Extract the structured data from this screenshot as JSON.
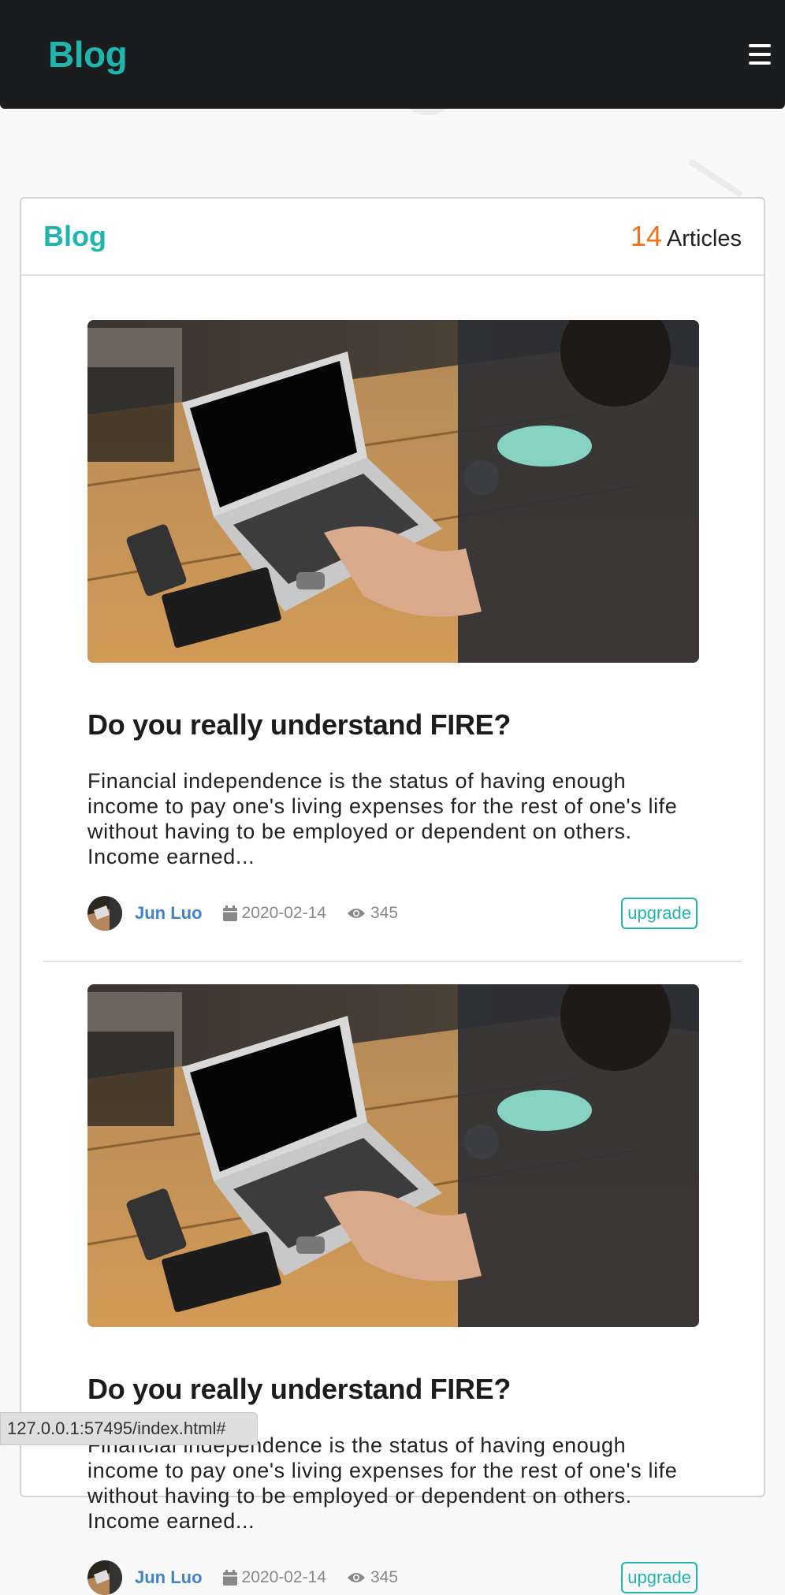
{
  "navbar": {
    "brand": "Blog",
    "menu_icon": "hamburger-menu-icon"
  },
  "card": {
    "title": "Blog",
    "count": "14",
    "count_label": "Articles"
  },
  "articles": [
    {
      "title": "Do you really understand FIRE?",
      "excerpt": "Financial independence is the status of having enough income to pay one's living expenses for the rest of one's life without having to be employed or dependent on others. Income earned...",
      "author": "Jun Luo",
      "date": "2020-02-14",
      "views": "345",
      "tag": "upgrade"
    },
    {
      "title": "Do you really understand FIRE?",
      "excerpt": "Financial independence is the status of having enough income to pay one's living expenses for the rest of one's life without having to be employed or dependent on others. Income earned...",
      "author": "Jun Luo",
      "date": "2020-02-14",
      "views": "345",
      "tag": "upgrade"
    }
  ],
  "statusbar": {
    "url": "127.0.0.1:57495/index.html#"
  },
  "colors": {
    "accent": "#1fb5ac",
    "count": "#f2711c",
    "author": "#4183c4",
    "navbar": "#1b1c1d"
  }
}
